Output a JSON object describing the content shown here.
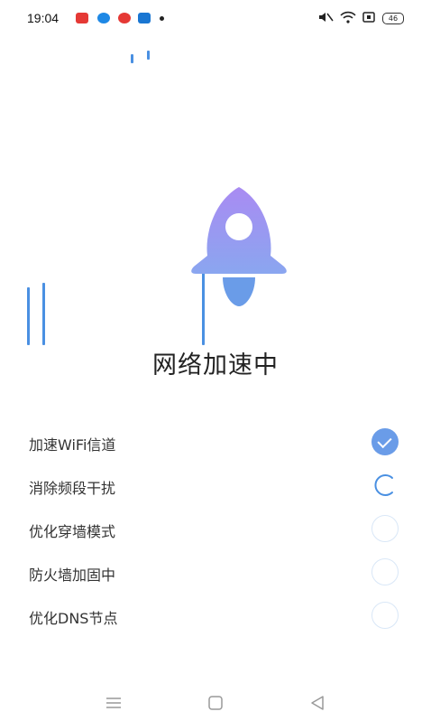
{
  "status_bar": {
    "time": "19:04",
    "battery": "46",
    "notification_icons": [
      "app-icon-red",
      "app-icon-blue",
      "app-icon-red-circle",
      "app-icon-blue-square"
    ],
    "system_icons": [
      "mute-icon",
      "wifi-icon",
      "screen-icon"
    ]
  },
  "main": {
    "title": "网络加速中"
  },
  "tasks": [
    {
      "label": "加速WiFi信道",
      "status": "done"
    },
    {
      "label": "消除频段干扰",
      "status": "in-progress"
    },
    {
      "label": "优化穿墙模式",
      "status": "pending"
    },
    {
      "label": "防火墙加固中",
      "status": "pending"
    },
    {
      "label": "优化DNS节点",
      "status": "pending"
    }
  ],
  "colors": {
    "accent": "#6a9ce8",
    "rocket_top": "#a98bf2",
    "rocket_bottom": "#6a9ce8",
    "speed_lines": "#4a90e2"
  },
  "nav_bar": {
    "buttons": [
      "menu-icon",
      "home-icon",
      "back-icon"
    ]
  }
}
